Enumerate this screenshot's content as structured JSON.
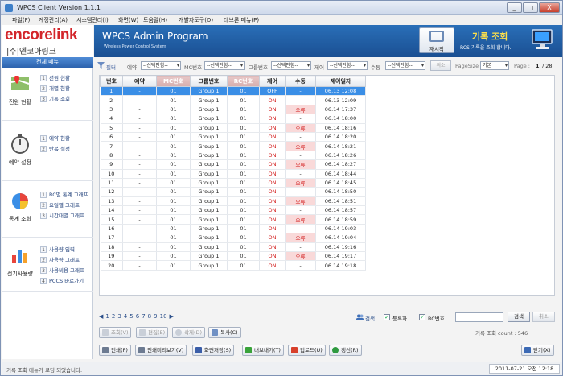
{
  "window": {
    "title": "WPCS Client Version 1.1.1",
    "min": "_",
    "max": "□",
    "close": "X"
  },
  "menubar": [
    "파일(F)",
    "계정관리(A)",
    "시스템관리(I)",
    "화면(W)",
    "도움말(H)",
    "개발자도구(D)",
    "데브론 메뉴(P)"
  ],
  "sidebar": {
    "logo": "encorelink",
    "logo_sub": "|주|엔코아링크",
    "menu_head": "전체 메뉴",
    "groups": [
      {
        "label": "전원 현황",
        "icon": "map-icon",
        "items": [
          {
            "n": "1",
            "t": "전원 현황"
          },
          {
            "n": "2",
            "t": "개별 현황"
          },
          {
            "n": "3",
            "t": "기록 조회"
          }
        ]
      },
      {
        "label": "예약 설정",
        "icon": "stopwatch-icon",
        "items": [
          {
            "n": "1",
            "t": "예약 현황"
          },
          {
            "n": "2",
            "t": "반복 설정"
          }
        ]
      },
      {
        "label": "통계 조회",
        "icon": "pie-chart-icon",
        "items": [
          {
            "n": "1",
            "t": "RC별 통계 그래프"
          },
          {
            "n": "2",
            "t": "요일별 그래프"
          },
          {
            "n": "3",
            "t": "시간대별 그래프"
          }
        ]
      },
      {
        "label": "전기사용량",
        "icon": "bar-chart-icon",
        "items": [
          {
            "n": "1",
            "t": "사용량 입력"
          },
          {
            "n": "2",
            "t": "사용량 그래프"
          },
          {
            "n": "3",
            "t": "사용비용 그래프"
          },
          {
            "n": "4",
            "t": "PCCS 바로가기"
          }
        ]
      }
    ]
  },
  "header": {
    "title": "WPCS Admin Program",
    "subtitle": "Wireless Power Control System",
    "restart": "재시작",
    "page_title": "기록 조회",
    "page_desc": "RCS 기록을 조회 합니다."
  },
  "filter": {
    "filter_label": "필터",
    "reserve_label": "예약",
    "reserve_value": "--선택안함--",
    "mc_label": "MC번호",
    "mc_value": "--선택안함--",
    "group_label": "그룹번호",
    "group_value": "--선택안함--",
    "control_label": "제어",
    "control_value": "--선택안함--",
    "manual_label": "수동",
    "manual_value": "--선택안함--",
    "cancel": "취소",
    "pagesize_label": "PageSize",
    "pagesize_value": "기본",
    "page_label": "Page :",
    "page_current": "1",
    "page_total": "/ 28"
  },
  "table": {
    "columns": [
      "번호",
      "예약",
      "MC번호",
      "그룹번호",
      "RC번호",
      "제어",
      "수동",
      "제어일자"
    ],
    "rows": [
      [
        "1",
        "-",
        "01",
        "Group 1",
        "01",
        "OFF",
        "-",
        "06.13 12:08"
      ],
      [
        "2",
        "-",
        "01",
        "Group 1",
        "01",
        "ON",
        "-",
        "06.13 12:09"
      ],
      [
        "3",
        "-",
        "01",
        "Group 1",
        "01",
        "ON",
        "오류",
        "06.14 17:37"
      ],
      [
        "4",
        "-",
        "01",
        "Group 1",
        "01",
        "ON",
        "-",
        "06.14 18:00"
      ],
      [
        "5",
        "-",
        "01",
        "Group 1",
        "01",
        "ON",
        "오류",
        "06.14 18:16"
      ],
      [
        "6",
        "-",
        "01",
        "Group 1",
        "01",
        "ON",
        "-",
        "06.14 18:20"
      ],
      [
        "7",
        "-",
        "01",
        "Group 1",
        "01",
        "ON",
        "오류",
        "06.14 18:21"
      ],
      [
        "8",
        "-",
        "01",
        "Group 1",
        "01",
        "ON",
        "-",
        "06.14 18:26"
      ],
      [
        "9",
        "-",
        "01",
        "Group 1",
        "01",
        "ON",
        "오류",
        "06.14 18:27"
      ],
      [
        "10",
        "-",
        "01",
        "Group 1",
        "01",
        "ON",
        "-",
        "06.14 18:44"
      ],
      [
        "11",
        "-",
        "01",
        "Group 1",
        "01",
        "ON",
        "오류",
        "06.14 18:45"
      ],
      [
        "12",
        "-",
        "01",
        "Group 1",
        "01",
        "ON",
        "-",
        "06.14 18:50"
      ],
      [
        "13",
        "-",
        "01",
        "Group 1",
        "01",
        "ON",
        "오류",
        "06.14 18:51"
      ],
      [
        "14",
        "-",
        "01",
        "Group 1",
        "01",
        "ON",
        "-",
        "06.14 18:57"
      ],
      [
        "15",
        "-",
        "01",
        "Group 1",
        "01",
        "ON",
        "오류",
        "06.14 18:59"
      ],
      [
        "16",
        "-",
        "01",
        "Group 1",
        "01",
        "ON",
        "-",
        "06.14 19:03"
      ],
      [
        "17",
        "-",
        "01",
        "Group 1",
        "01",
        "ON",
        "오류",
        "06.14 19:04"
      ],
      [
        "18",
        "-",
        "01",
        "Group 1",
        "01",
        "ON",
        "-",
        "06.14 19:16"
      ],
      [
        "19",
        "-",
        "01",
        "Group 1",
        "01",
        "ON",
        "오류",
        "06.14 19:17"
      ],
      [
        "20",
        "-",
        "01",
        "Group 1",
        "01",
        "ON",
        "-",
        "06.14 19:18"
      ]
    ]
  },
  "pager": {
    "prev": "◀",
    "pages": [
      "1",
      "2",
      "3",
      "4",
      "5",
      "6",
      "7",
      "8",
      "9",
      "10"
    ],
    "next": "▶"
  },
  "search": {
    "search_link": "검색",
    "registrant_label": "등록자",
    "rc_label": "RC번호",
    "search_btn": "검색",
    "cancel_btn": "취소"
  },
  "record_count": "기록 조회 count : 546",
  "actions_row1": {
    "view": "조회(V)",
    "edit": "편집(E)",
    "delete": "삭제(D)",
    "copy": "복사(C)"
  },
  "actions_row2": {
    "print": "인쇄(P)",
    "preview": "인쇄미리보기(V)",
    "save_screen": "화면저장(S)",
    "export": "내보내기(T)",
    "upload": "업로드(U)",
    "refresh": "갱신(R)",
    "close": "닫기(X)"
  },
  "status": {
    "message": "기록 조회 메뉴가 로딩 되었습니다.",
    "datetime": "2011-07-21 오전 12:18"
  },
  "colors": {
    "header": "#1f5aa0",
    "selected_row": "#3a8ee6",
    "on_text": "#d01414",
    "error_bg": "#f9d9d9",
    "logo_red": "#d3262b",
    "title_yellow": "#ffe14a"
  }
}
